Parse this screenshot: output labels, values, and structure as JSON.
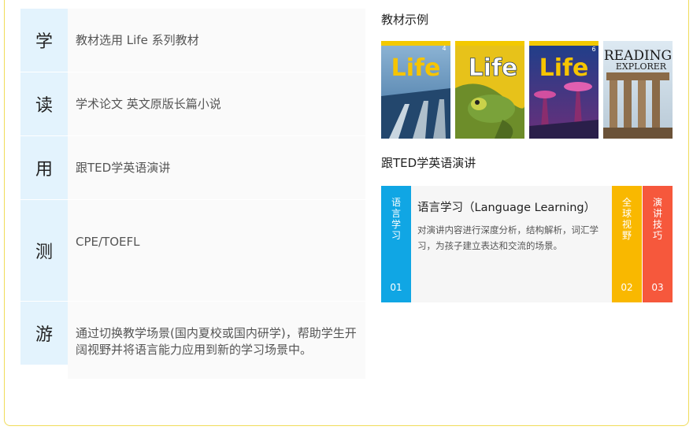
{
  "rows": [
    {
      "key": "学",
      "value": "教材选用 Life 系列教材"
    },
    {
      "key": "读",
      "value": "学术论文 英文原版长篇小说"
    },
    {
      "key": "用",
      "value": "跟TED学英语演讲"
    },
    {
      "key": "测",
      "value": "CPE/TOEFL"
    },
    {
      "key": "游",
      "value": "通过切换教学场景(国内夏校或国内研学)，帮助学生开阔视野并将语言能力应用到新的学习场景中。"
    }
  ],
  "textbook_section": {
    "title": "教材示例",
    "covers": [
      {
        "title": "Life",
        "number": "4"
      },
      {
        "title": "Life",
        "number": ""
      },
      {
        "title": "Life",
        "number": "6"
      },
      {
        "title": "READING",
        "subtitle": "EXPLORER"
      }
    ]
  },
  "ted_section": {
    "title": "跟TED学英语演讲",
    "tabs": [
      {
        "label": "语言学习",
        "number": "01"
      },
      {
        "label": "全球视野",
        "number": "02"
      },
      {
        "label": "演讲技巧",
        "number": "03"
      }
    ],
    "panel": {
      "title": "语言学习（Language Learning）",
      "description": "对演讲内容进行深度分析，结构解析，词汇学习，为孩子建立表达和交流的场景。"
    }
  },
  "colors": {
    "frame_border": "#f0dc5a",
    "key_bg": "#e3f3fd",
    "tab1": "#10a6e4",
    "tab2": "#f9b800",
    "tab3": "#f6583c"
  }
}
